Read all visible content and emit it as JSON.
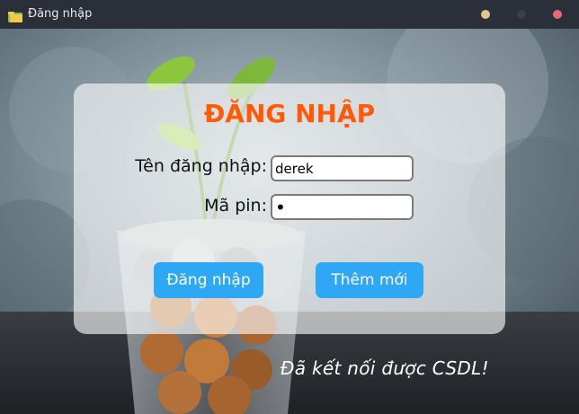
{
  "window": {
    "title": "Đăng nhập",
    "icon": "folder-icon",
    "controls": [
      "minimize-button",
      "maximize-button",
      "close-button"
    ]
  },
  "login": {
    "heading": "ĐĂNG NHẬP",
    "username_label": "Tên đăng nhập:",
    "username_value": "derek",
    "pin_label": "Mã pin:",
    "pin_value": "•",
    "login_button": "Đăng nhập",
    "add_button": "Thêm mới"
  },
  "status": {
    "message": "Đã kết nối được CSDL!"
  },
  "colors": {
    "heading": "#ff5a0a",
    "button": "#2ea8f4",
    "titlebar": "#2b2f3a"
  }
}
